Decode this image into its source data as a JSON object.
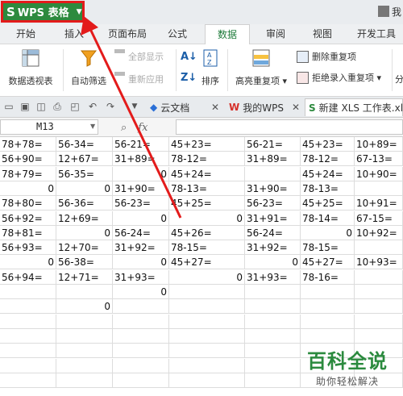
{
  "app": {
    "menu_label": "WPS 表格",
    "menu_glyph": "S",
    "user_label": "我"
  },
  "tabs": [
    {
      "label": "开始"
    },
    {
      "label": "插入"
    },
    {
      "label": "页面布局"
    },
    {
      "label": "公式"
    },
    {
      "label": "数据",
      "active": true
    },
    {
      "label": "审阅"
    },
    {
      "label": "视图"
    },
    {
      "label": "开发工具"
    }
  ],
  "ribbon": {
    "pivot": "数据透视表",
    "autofilter": "自动筛选",
    "show_all": "全部显示",
    "reapply": "重新应用",
    "sort": "排序",
    "highlight_dup": "高亮重复项",
    "remove_dup": "删除重复项",
    "reject_dup": "拒绝录入重复项",
    "split": "分"
  },
  "docbar": {
    "cloud": "云文档",
    "mywps": "我的WPS",
    "active_file": "新建 XLS 工作表.xls"
  },
  "formula_bar": {
    "name_box": "M13",
    "fx": "fx",
    "cancel": "✕"
  },
  "grid": {
    "rows": [
      [
        "78+78=",
        "56-34=",
        "56-21=",
        "45+23=",
        "56-21=",
        "45+23=",
        "10+89="
      ],
      [
        "56+90=",
        "12+67=",
        "31+89=",
        "78-12=",
        "31+89=",
        "78-12=",
        "67-13="
      ],
      [
        "78+79=",
        "56-35=",
        "0",
        "45+24=",
        "",
        "45+24=",
        "10+90="
      ],
      [
        "0",
        "0",
        "31+90=",
        "78-13=",
        "31+90=",
        "78-13=",
        ""
      ],
      [
        "78+80=",
        "56-36=",
        "56-23=",
        "45+25=",
        "56-23=",
        "45+25=",
        "10+91="
      ],
      [
        "56+92=",
        "12+69=",
        "0",
        "0",
        "31+91=",
        "78-14=",
        "67-15="
      ],
      [
        "78+81=",
        "0",
        "56-24=",
        "45+26=",
        "56-24=",
        "0",
        "10+92="
      ],
      [
        "56+93=",
        "12+70=",
        "31+92=",
        "78-15=",
        "31+92=",
        "78-15=",
        ""
      ],
      [
        "0",
        "56-38=",
        "0",
        "45+27=",
        "0",
        "45+27=",
        "10+93="
      ],
      [
        "56+94=",
        "12+71=",
        "31+93=",
        "0",
        "31+93=",
        "78-16=",
        ""
      ],
      [
        "",
        "",
        "0",
        "",
        "",
        "",
        ""
      ],
      [
        "",
        "0",
        "",
        "",
        "",
        "",
        ""
      ],
      [
        "",
        "",
        "",
        "",
        "",
        "",
        ""
      ],
      [
        "",
        "",
        "",
        "",
        "",
        "",
        ""
      ],
      [
        "",
        "",
        "",
        "",
        "",
        "",
        ""
      ],
      [
        "",
        "",
        "",
        "",
        "",
        "",
        ""
      ],
      [
        "",
        "",
        "",
        "",
        "",
        "",
        ""
      ]
    ]
  },
  "watermark": {
    "title": "百科全说",
    "subtitle": "助你轻松解决"
  },
  "colors": {
    "wps_green": "#2d8a3e",
    "highlight_red": "#e31b1b",
    "active_tab_text": "#1e7b3a"
  }
}
